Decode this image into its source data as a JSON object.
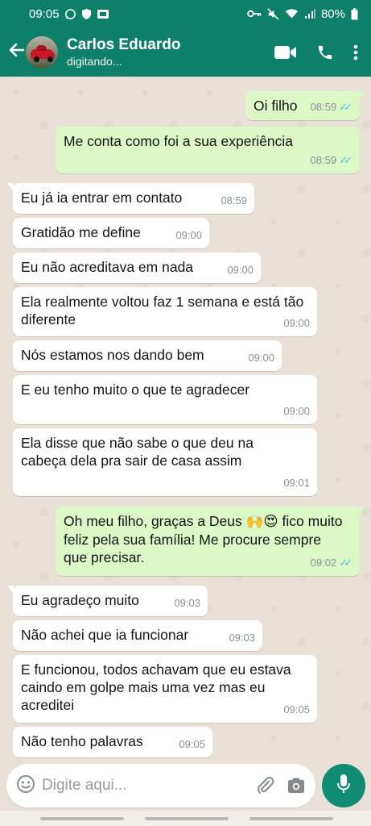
{
  "status_bar": {
    "time": "09:05",
    "battery": "80%"
  },
  "header": {
    "contact_name": "Carlos Eduardo",
    "contact_status": "digitando..."
  },
  "messages": [
    {
      "dir": "out",
      "text": "Oi filho",
      "time": "08:59",
      "read": true
    },
    {
      "dir": "out",
      "text": "Me conta como foi a sua experiência",
      "time": "08:59",
      "read": true
    },
    {
      "dir": "in",
      "text": "Eu já ia entrar em contato",
      "time": "08:59"
    },
    {
      "dir": "in",
      "text": "Gratidão me define",
      "time": "09:00"
    },
    {
      "dir": "in",
      "text": "Eu não acreditava em nada",
      "time": "09:00"
    },
    {
      "dir": "in",
      "text": "Ela realmente voltou faz 1 semana e está tão diferente",
      "time": "09:00"
    },
    {
      "dir": "in",
      "text": "Nós estamos nos dando bem",
      "time": "09:00"
    },
    {
      "dir": "in",
      "text": "E eu tenho muito o que te agradecer",
      "time": "09:00"
    },
    {
      "dir": "in",
      "text": "Ela disse que não sabe o que deu na cabeça dela pra sair de casa assim",
      "time": "09:01"
    },
    {
      "dir": "out",
      "text_before": "Oh meu filho, graças a Deus ",
      "emoji": "🙌😍",
      "text_after": " fico muito feliz pela sua família! Me procure sempre que precisar.",
      "time": "09:02",
      "read": true
    },
    {
      "dir": "in",
      "text": "Eu agradeço muito",
      "time": "09:03"
    },
    {
      "dir": "in",
      "text": "Não achei que ia funcionar",
      "time": "09:03"
    },
    {
      "dir": "in",
      "text": "E funcionou, todos achavam que eu estava caindo em golpe mais uma vez mas eu acreditei",
      "time": "09:05"
    },
    {
      "dir": "in",
      "text": "Não tenho palavras",
      "time": "09:05"
    }
  ],
  "composer": {
    "placeholder": "Digite aqui..."
  },
  "icons": [
    "arrow-left-icon",
    "video-call-icon",
    "phone-icon",
    "more-vert-icon",
    "emoji-icon",
    "attach-icon",
    "camera-icon",
    "mic-icon"
  ],
  "colors": {
    "header": "#0e806a",
    "outgoing_bubble": "#dcf8c6",
    "incoming_bubble": "#ffffff",
    "read_ticks": "#53bdeb",
    "mic_button": "#0f8c72"
  }
}
